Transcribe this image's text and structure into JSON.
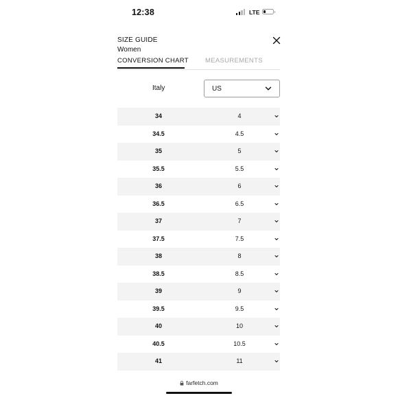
{
  "status_bar": {
    "time": "12:38",
    "network": "LTE",
    "signal_bars_active": 2,
    "signal_bars_total": 4,
    "battery_level_percent": 15
  },
  "header": {
    "title": "SIZE GUIDE",
    "subtitle": "Women",
    "close_icon": "close-icon"
  },
  "tabs": [
    {
      "label": "CONVERSION CHART",
      "active": true
    },
    {
      "label": "MEASUREMENTS",
      "active": false
    }
  ],
  "converter": {
    "source_region": "Italy",
    "target_region": "US",
    "select_icon": "chevron-down-icon"
  },
  "size_rows": [
    {
      "italy": "34",
      "us": "4"
    },
    {
      "italy": "34.5",
      "us": "4.5"
    },
    {
      "italy": "35",
      "us": "5"
    },
    {
      "italy": "35.5",
      "us": "5.5"
    },
    {
      "italy": "36",
      "us": "6"
    },
    {
      "italy": "36.5",
      "us": "6.5"
    },
    {
      "italy": "37",
      "us": "7"
    },
    {
      "italy": "37.5",
      "us": "7.5"
    },
    {
      "italy": "38",
      "us": "8"
    },
    {
      "italy": "38.5",
      "us": "8.5"
    },
    {
      "italy": "39",
      "us": "9"
    },
    {
      "italy": "39.5",
      "us": "9.5"
    },
    {
      "italy": "40",
      "us": "10"
    },
    {
      "italy": "40.5",
      "us": "10.5"
    },
    {
      "italy": "41",
      "us": "11"
    }
  ],
  "browser": {
    "url": "farfetch.com",
    "lock_icon": "lock-icon"
  },
  "colors": {
    "text": "#111111",
    "inactive_tab": "#a8a8a8",
    "row_shade": "#f3f3f3",
    "border": "#9c9c9c"
  }
}
